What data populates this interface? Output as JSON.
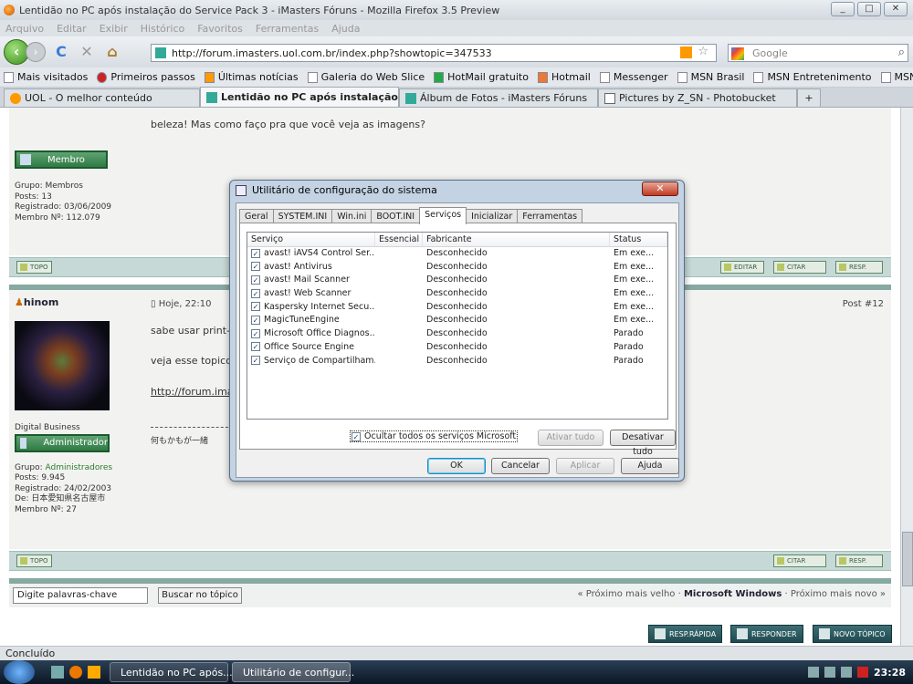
{
  "window": {
    "title": "Lentidão no PC após instalação do Service Pack 3 - iMasters Fóruns - Mozilla Firefox 3.5 Preview",
    "controls": [
      "_",
      "□",
      "✕"
    ]
  },
  "menu": [
    "Arquivo",
    "Editar",
    "Exibir",
    "Histórico",
    "Favoritos",
    "Ferramentas",
    "Ajuda"
  ],
  "nav": {
    "url": "http://forum.imasters.uol.com.br/index.php?showtopic=347533",
    "search_placeholder": "Google"
  },
  "bookmarks": [
    "Mais visitados",
    "Primeiros passos",
    "Últimas notícias",
    "Galeria do Web Slice",
    "HotMail gratuito",
    "Hotmail",
    "Messenger",
    "MSN Brasil",
    "MSN Entretenimento",
    "MSN Esporte"
  ],
  "tabs": [
    {
      "label": "UOL - O melhor conteúdo",
      "active": false
    },
    {
      "label": "Lentidão no PC após instalação do ...",
      "active": true
    },
    {
      "label": "Álbum de Fotos - iMasters Fóruns",
      "active": false
    },
    {
      "label": "Pictures by Z_SN - Photobucket",
      "active": false
    }
  ],
  "post1": {
    "text": "beleza! Mas como faço pra que você veja as imagens?",
    "rank": "Membro",
    "info": [
      "Grupo: Membros",
      "Posts: 13",
      "Registrado: 03/06/2009",
      "Membro Nº: 112.079"
    ],
    "top_label": "TOPO",
    "actions": [
      "EDITAR",
      "CITAR",
      "RESP."
    ]
  },
  "post2": {
    "author": "hinom",
    "date": "Hoje, 22:10",
    "post_number": "Post #12",
    "lines": [
      "sabe usar print-",
      "veja esse topico",
      "http://forum.ima"
    ],
    "signature": "何もかもが一緒",
    "title_text": "Digital Business",
    "rank": "Administrador",
    "info_group_label": "Grupo: ",
    "info_group": "Administradores",
    "info": [
      "Posts: 9.945",
      "Registrado: 24/02/2003",
      "De: 日本愛知県名古屋市",
      "Membro Nº: 27"
    ],
    "top_label": "TOPO",
    "actions": [
      "CITAR",
      "RESP."
    ]
  },
  "footer": {
    "search_value": "Digite palavras-chave",
    "search_button": "Buscar no tópico",
    "prev": "« Próximo mais velho",
    "sep": " · ",
    "current": "Microsoft Windows",
    "next": "Próximo mais novo »",
    "buttons": [
      "RESP.RÁPIDA",
      "RESPONDER",
      "NOVO TÓPICO"
    ]
  },
  "status": "Concluído",
  "taskbar": {
    "items": [
      "Lentidão no PC após...",
      "Utilitário de configur..."
    ],
    "time": "23:28"
  },
  "dialog": {
    "title": "Utilitário de configuração do sistema",
    "close": "✕",
    "tabs": [
      "Geral",
      "SYSTEM.INI",
      "Win.ini",
      "BOOT.INI",
      "Serviços",
      "Inicializar",
      "Ferramentas"
    ],
    "active_tab": "Serviços",
    "columns": [
      "Serviço",
      "Essencial",
      "Fabricante",
      "Status"
    ],
    "rows": [
      {
        "service": "avast! iAVS4 Control Ser...",
        "essential": "",
        "maker": "Desconhecido",
        "status": "Em exe..."
      },
      {
        "service": "avast! Antivirus",
        "essential": "",
        "maker": "Desconhecido",
        "status": "Em exe..."
      },
      {
        "service": "avast! Mail Scanner",
        "essential": "",
        "maker": "Desconhecido",
        "status": "Em exe..."
      },
      {
        "service": "avast! Web Scanner",
        "essential": "",
        "maker": "Desconhecido",
        "status": "Em exe..."
      },
      {
        "service": "Kaspersky Internet Secu...",
        "essential": "",
        "maker": "Desconhecido",
        "status": "Em exe..."
      },
      {
        "service": "MagicTuneEngine",
        "essential": "",
        "maker": "Desconhecido",
        "status": "Em exe..."
      },
      {
        "service": "Microsoft Office Diagnos...",
        "essential": "",
        "maker": "Desconhecido",
        "status": "Parado"
      },
      {
        "service": "Office Source Engine",
        "essential": "",
        "maker": "Desconhecido",
        "status": "Parado"
      },
      {
        "service": "Serviço de Compartilham...",
        "essential": "",
        "maker": "Desconhecido",
        "status": "Parado"
      }
    ],
    "hide_ms": "Ocultar todos os serviços Microsoft",
    "enable_all": "Ativar tudo",
    "disable_all": "Desativar tudo",
    "ok": "OK",
    "cancel": "Cancelar",
    "apply": "Aplicar",
    "help": "Ajuda"
  }
}
